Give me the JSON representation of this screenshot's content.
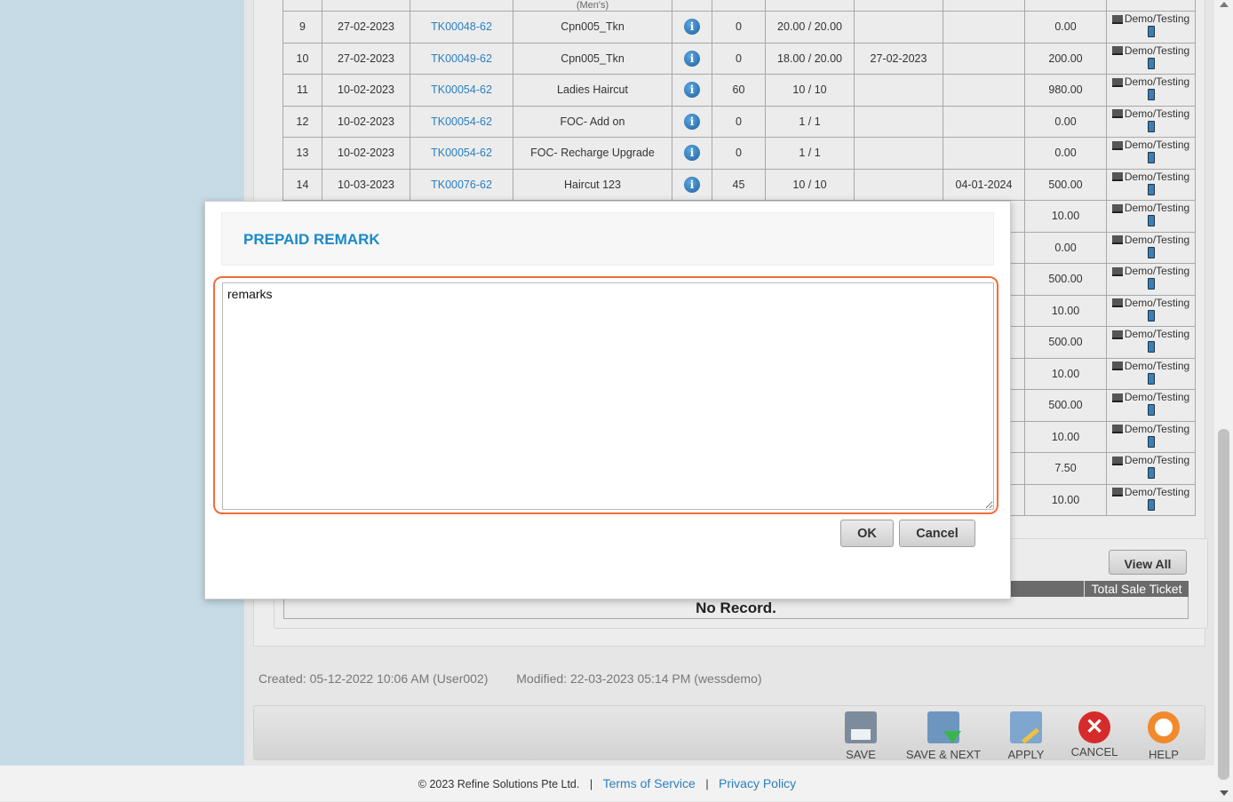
{
  "table": {
    "top_row": {
      "partial_text": "(Men's)"
    },
    "rows": [
      {
        "no": "9",
        "date": "27-02-2023",
        "ticket": "TK00048-62",
        "service": "Cpn005_Tkn",
        "qty": "0",
        "balance": "20.00 / 20.00",
        "date2": "",
        "expiry": "",
        "amount": "0.00",
        "agent": "Demo/Testing"
      },
      {
        "no": "10",
        "date": "27-02-2023",
        "ticket": "TK00049-62",
        "service": "Cpn005_Tkn",
        "qty": "0",
        "balance": "18.00 / 20.00",
        "date2": "27-02-2023",
        "expiry": "",
        "amount": "200.00",
        "agent": "Demo/Testing"
      },
      {
        "no": "11",
        "date": "10-02-2023",
        "ticket": "TK00054-62",
        "service": "Ladies Haircut",
        "qty": "60",
        "balance": "10 / 10",
        "date2": "",
        "expiry": "",
        "amount": "980.00",
        "agent": "Demo/Testing"
      },
      {
        "no": "12",
        "date": "10-02-2023",
        "ticket": "TK00054-62",
        "service": "FOC- Add on",
        "qty": "0",
        "balance": "1 / 1",
        "date2": "",
        "expiry": "",
        "amount": "0.00",
        "agent": "Demo/Testing"
      },
      {
        "no": "13",
        "date": "10-02-2023",
        "ticket": "TK00054-62",
        "service": "FOC- Recharge Upgrade",
        "qty": "0",
        "balance": "1 / 1",
        "date2": "",
        "expiry": "",
        "amount": "0.00",
        "agent": "Demo/Testing"
      },
      {
        "no": "14",
        "date": "10-03-2023",
        "ticket": "TK00076-62",
        "service": "Haircut 123",
        "qty": "45",
        "balance": "10 / 10",
        "date2": "",
        "expiry": "04-01-2024",
        "amount": "500.00",
        "agent": "Demo/Testing"
      },
      {
        "no": "",
        "date": "",
        "ticket": "",
        "service": "",
        "qty": "",
        "balance": "",
        "date2": "",
        "expiry": "",
        "amount": "10.00",
        "agent": "Demo/Testing"
      },
      {
        "no": "",
        "date": "",
        "ticket": "",
        "service": "",
        "qty": "",
        "balance": "",
        "date2": "",
        "expiry": "",
        "amount": "0.00",
        "agent": "Demo/Testing"
      },
      {
        "no": "",
        "date": "",
        "ticket": "",
        "service": "",
        "qty": "",
        "balance": "",
        "date2": "",
        "expiry": "",
        "amount": "500.00",
        "agent": "Demo/Testing"
      },
      {
        "no": "",
        "date": "",
        "ticket": "",
        "service": "",
        "qty": "",
        "balance": "",
        "date2": "",
        "expiry": "",
        "amount": "10.00",
        "agent": "Demo/Testing"
      },
      {
        "no": "",
        "date": "",
        "ticket": "",
        "service": "",
        "qty": "",
        "balance": "",
        "date2": "",
        "expiry": "",
        "amount": "500.00",
        "agent": "Demo/Testing"
      },
      {
        "no": "",
        "date": "",
        "ticket": "",
        "service": "",
        "qty": "",
        "balance": "",
        "date2": "",
        "expiry": "",
        "amount": "10.00",
        "agent": "Demo/Testing"
      },
      {
        "no": "",
        "date": "",
        "ticket": "",
        "service": "",
        "qty": "",
        "balance": "",
        "date2": "",
        "expiry": "",
        "amount": "500.00",
        "agent": "Demo/Testing"
      },
      {
        "no": "",
        "date": "",
        "ticket": "",
        "service": "",
        "qty": "",
        "balance": "",
        "date2": "",
        "expiry": "",
        "amount": "10.00",
        "agent": "Demo/Testing"
      },
      {
        "no": "",
        "date": "",
        "ticket": "",
        "service": "",
        "qty": "",
        "balance": "",
        "date2": "",
        "expiry": "",
        "amount": "7.50",
        "agent": "Demo/Testing"
      },
      {
        "no": "",
        "date": "",
        "ticket": "",
        "service": "",
        "qty": "",
        "balance": "",
        "date2": "",
        "expiry": "",
        "amount": "10.00",
        "agent": "Demo/Testing"
      }
    ],
    "info_icon_glyph": "i",
    "icons": {
      "info": "info-icon",
      "laptop": "laptop-icon",
      "phone": "phone-icon"
    }
  },
  "sub_panel": {
    "view_all_label": "View All",
    "column_header": "Total Sale Ticket",
    "empty_text": "No Record."
  },
  "meta": {
    "created": "Created: 05-12-2022 10:06 AM (User002)",
    "modified": "Modified: 22-03-2023 05:14 PM (wessdemo)"
  },
  "toolbar": {
    "save": "SAVE",
    "save_next": "SAVE & NEXT",
    "apply": "APPLY",
    "cancel": "CANCEL",
    "help": "HELP",
    "cancel_glyph": "✕"
  },
  "footer": {
    "copyright": "© 2023 Refine Solutions Pte Ltd.",
    "separator": "|",
    "terms": "Terms of Service",
    "privacy": "Privacy Policy"
  },
  "modal": {
    "title": "PREPAID REMARK",
    "remarks_value": "remarks",
    "ok_label": "OK",
    "cancel_label": "Cancel"
  },
  "colors": {
    "accent": "#1a8ac8",
    "link": "#2a7fc1",
    "focus": "#f26c3a",
    "side_panel": "#c6dbe5"
  }
}
